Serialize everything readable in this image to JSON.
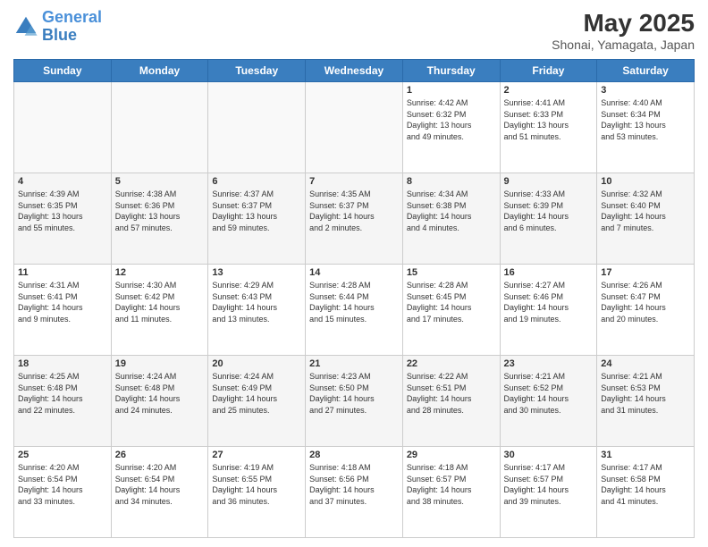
{
  "header": {
    "logo_line1": "General",
    "logo_line2": "Blue",
    "title": "May 2025",
    "subtitle": "Shonai, Yamagata, Japan"
  },
  "days_of_week": [
    "Sunday",
    "Monday",
    "Tuesday",
    "Wednesday",
    "Thursday",
    "Friday",
    "Saturday"
  ],
  "weeks": [
    [
      {
        "day": "",
        "info": ""
      },
      {
        "day": "",
        "info": ""
      },
      {
        "day": "",
        "info": ""
      },
      {
        "day": "",
        "info": ""
      },
      {
        "day": "1",
        "info": "Sunrise: 4:42 AM\nSunset: 6:32 PM\nDaylight: 13 hours\nand 49 minutes."
      },
      {
        "day": "2",
        "info": "Sunrise: 4:41 AM\nSunset: 6:33 PM\nDaylight: 13 hours\nand 51 minutes."
      },
      {
        "day": "3",
        "info": "Sunrise: 4:40 AM\nSunset: 6:34 PM\nDaylight: 13 hours\nand 53 minutes."
      }
    ],
    [
      {
        "day": "4",
        "info": "Sunrise: 4:39 AM\nSunset: 6:35 PM\nDaylight: 13 hours\nand 55 minutes."
      },
      {
        "day": "5",
        "info": "Sunrise: 4:38 AM\nSunset: 6:36 PM\nDaylight: 13 hours\nand 57 minutes."
      },
      {
        "day": "6",
        "info": "Sunrise: 4:37 AM\nSunset: 6:37 PM\nDaylight: 13 hours\nand 59 minutes."
      },
      {
        "day": "7",
        "info": "Sunrise: 4:35 AM\nSunset: 6:37 PM\nDaylight: 14 hours\nand 2 minutes."
      },
      {
        "day": "8",
        "info": "Sunrise: 4:34 AM\nSunset: 6:38 PM\nDaylight: 14 hours\nand 4 minutes."
      },
      {
        "day": "9",
        "info": "Sunrise: 4:33 AM\nSunset: 6:39 PM\nDaylight: 14 hours\nand 6 minutes."
      },
      {
        "day": "10",
        "info": "Sunrise: 4:32 AM\nSunset: 6:40 PM\nDaylight: 14 hours\nand 7 minutes."
      }
    ],
    [
      {
        "day": "11",
        "info": "Sunrise: 4:31 AM\nSunset: 6:41 PM\nDaylight: 14 hours\nand 9 minutes."
      },
      {
        "day": "12",
        "info": "Sunrise: 4:30 AM\nSunset: 6:42 PM\nDaylight: 14 hours\nand 11 minutes."
      },
      {
        "day": "13",
        "info": "Sunrise: 4:29 AM\nSunset: 6:43 PM\nDaylight: 14 hours\nand 13 minutes."
      },
      {
        "day": "14",
        "info": "Sunrise: 4:28 AM\nSunset: 6:44 PM\nDaylight: 14 hours\nand 15 minutes."
      },
      {
        "day": "15",
        "info": "Sunrise: 4:28 AM\nSunset: 6:45 PM\nDaylight: 14 hours\nand 17 minutes."
      },
      {
        "day": "16",
        "info": "Sunrise: 4:27 AM\nSunset: 6:46 PM\nDaylight: 14 hours\nand 19 minutes."
      },
      {
        "day": "17",
        "info": "Sunrise: 4:26 AM\nSunset: 6:47 PM\nDaylight: 14 hours\nand 20 minutes."
      }
    ],
    [
      {
        "day": "18",
        "info": "Sunrise: 4:25 AM\nSunset: 6:48 PM\nDaylight: 14 hours\nand 22 minutes."
      },
      {
        "day": "19",
        "info": "Sunrise: 4:24 AM\nSunset: 6:48 PM\nDaylight: 14 hours\nand 24 minutes."
      },
      {
        "day": "20",
        "info": "Sunrise: 4:24 AM\nSunset: 6:49 PM\nDaylight: 14 hours\nand 25 minutes."
      },
      {
        "day": "21",
        "info": "Sunrise: 4:23 AM\nSunset: 6:50 PM\nDaylight: 14 hours\nand 27 minutes."
      },
      {
        "day": "22",
        "info": "Sunrise: 4:22 AM\nSunset: 6:51 PM\nDaylight: 14 hours\nand 28 minutes."
      },
      {
        "day": "23",
        "info": "Sunrise: 4:21 AM\nSunset: 6:52 PM\nDaylight: 14 hours\nand 30 minutes."
      },
      {
        "day": "24",
        "info": "Sunrise: 4:21 AM\nSunset: 6:53 PM\nDaylight: 14 hours\nand 31 minutes."
      }
    ],
    [
      {
        "day": "25",
        "info": "Sunrise: 4:20 AM\nSunset: 6:54 PM\nDaylight: 14 hours\nand 33 minutes."
      },
      {
        "day": "26",
        "info": "Sunrise: 4:20 AM\nSunset: 6:54 PM\nDaylight: 14 hours\nand 34 minutes."
      },
      {
        "day": "27",
        "info": "Sunrise: 4:19 AM\nSunset: 6:55 PM\nDaylight: 14 hours\nand 36 minutes."
      },
      {
        "day": "28",
        "info": "Sunrise: 4:18 AM\nSunset: 6:56 PM\nDaylight: 14 hours\nand 37 minutes."
      },
      {
        "day": "29",
        "info": "Sunrise: 4:18 AM\nSunset: 6:57 PM\nDaylight: 14 hours\nand 38 minutes."
      },
      {
        "day": "30",
        "info": "Sunrise: 4:17 AM\nSunset: 6:57 PM\nDaylight: 14 hours\nand 39 minutes."
      },
      {
        "day": "31",
        "info": "Sunrise: 4:17 AM\nSunset: 6:58 PM\nDaylight: 14 hours\nand 41 minutes."
      }
    ]
  ]
}
